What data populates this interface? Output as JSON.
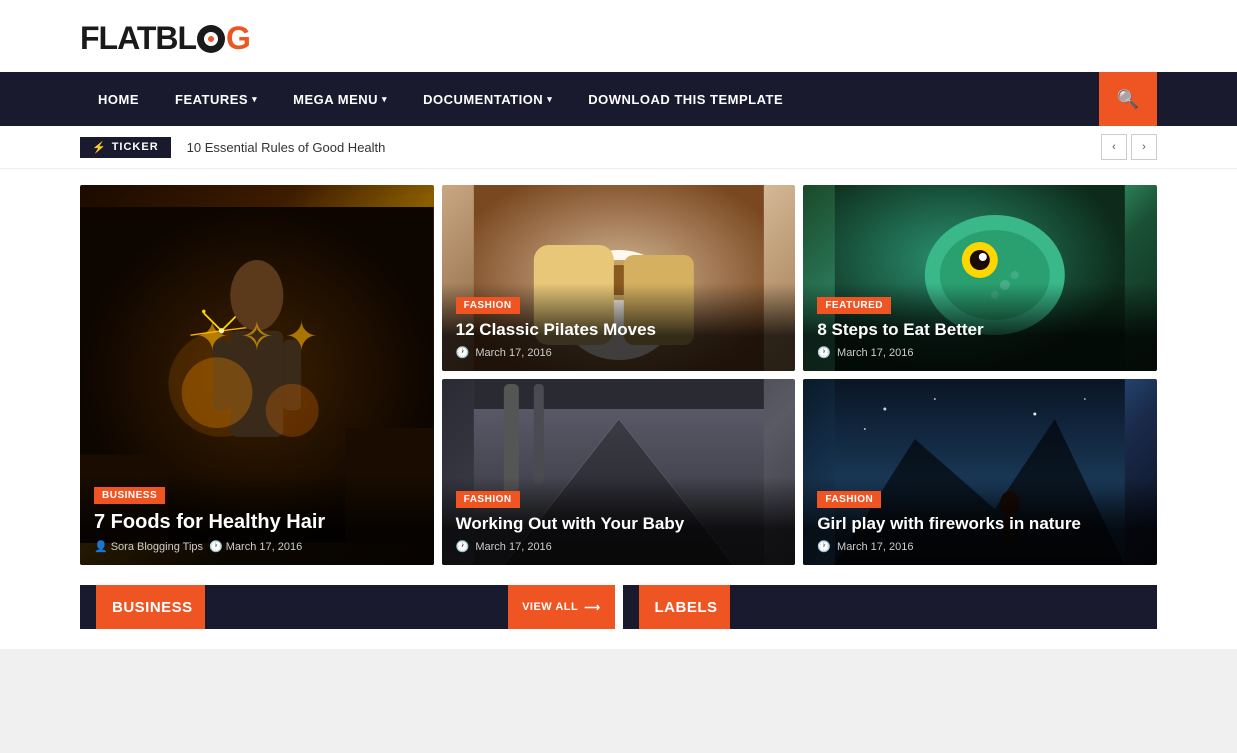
{
  "logo": {
    "text_flat": "FLATBL",
    "text_g": "G"
  },
  "nav": {
    "items": [
      {
        "label": "HOME",
        "hasDropdown": false
      },
      {
        "label": "FEATURES",
        "hasDropdown": true
      },
      {
        "label": "MEGA MENU",
        "hasDropdown": true
      },
      {
        "label": "DOCUMENTATION",
        "hasDropdown": true
      },
      {
        "label": "DOWNLOAD THIS TEMPLATE",
        "hasDropdown": false
      }
    ]
  },
  "ticker": {
    "label": "TICKER",
    "bolt": "⚡",
    "text": "10 Essential Rules of Good Health"
  },
  "cards": [
    {
      "id": "large",
      "badge": "BUSINESS",
      "title": "7 Foods for Healthy Hair",
      "author": "Sora Blogging Tips",
      "date": "March 17, 2016",
      "imgClass": "img-fireworks-woman",
      "size": "large"
    },
    {
      "id": "top-mid",
      "badge": "FASHION",
      "title": "12 Classic Pilates Moves",
      "date": "March 17, 2016",
      "imgClass": "img-coffee",
      "size": "small"
    },
    {
      "id": "top-right",
      "badge": "FEATURED",
      "title": "8 Steps to Eat Better",
      "date": "March 17, 2016",
      "imgClass": "img-lizard",
      "size": "small"
    },
    {
      "id": "bot-mid",
      "badge": "FASHION",
      "title": "Working Out with Your Baby",
      "date": "March 17, 2016",
      "imgClass": "img-hallway",
      "size": "small"
    },
    {
      "id": "bot-right",
      "badge": "FASHION",
      "title": "Girl play with fireworks in nature",
      "date": "March 17, 2016",
      "imgClass": "img-mountain-blue",
      "size": "small"
    }
  ],
  "bottom": {
    "business_label": "BUSINESS",
    "view_all_label": "VIEW ALL",
    "labels_label": "LABELS"
  }
}
